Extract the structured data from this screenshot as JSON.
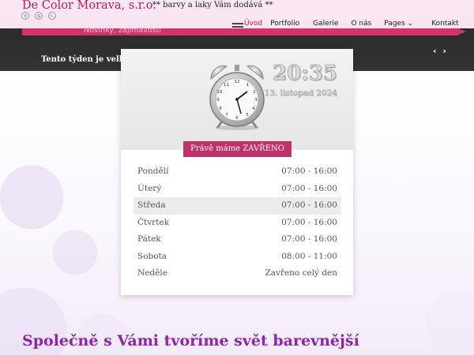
{
  "header": {
    "brand": "De Color Morava, s.r.o.",
    "tagline": "** barvy a laky Vám dodává **",
    "social_icons": [
      "facebook-icon",
      "skype-icon",
      "whatsapp-icon"
    ]
  },
  "nav": {
    "news_link": "Novinky, zajímavosti",
    "items": [
      {
        "label": "Úvod",
        "active": true
      },
      {
        "label": "Portfolio"
      },
      {
        "label": "Galerie"
      },
      {
        "label": "O nás"
      },
      {
        "label": "Pages ⌄"
      },
      {
        "label": "Kontakt"
      }
    ],
    "ticker": "Tento týden je velký",
    "slider_arrows": "‹ ›"
  },
  "card": {
    "time": "20:35",
    "date": "13. listopad 2024",
    "status": "Právě máme ZAVŘENO",
    "hours": [
      {
        "day": "Pondělí",
        "hours": "07:00 - 16:00"
      },
      {
        "day": "Úterý",
        "hours": "07:00 - 16:00"
      },
      {
        "day": "Středa",
        "hours": "07:00 - 16:00",
        "highlight": true
      },
      {
        "day": "Čtvrtek",
        "hours": "07:00 - 16:00"
      },
      {
        "day": "Pátek",
        "hours": "07:00 - 16:00"
      },
      {
        "day": "Sobota",
        "hours": "08:00 - 11:00"
      },
      {
        "day": "Neděle",
        "hours": "Zavřeno celý den"
      }
    ]
  },
  "main": {
    "headline": "Společně s Vámi tvoříme svět barevnější"
  },
  "colors": {
    "brand": "#c2185b",
    "accent_bar": "#d6336c",
    "status_bg": "#c0306a",
    "headline": "#8e24aa",
    "nav_dark": "#2b2b2b"
  }
}
